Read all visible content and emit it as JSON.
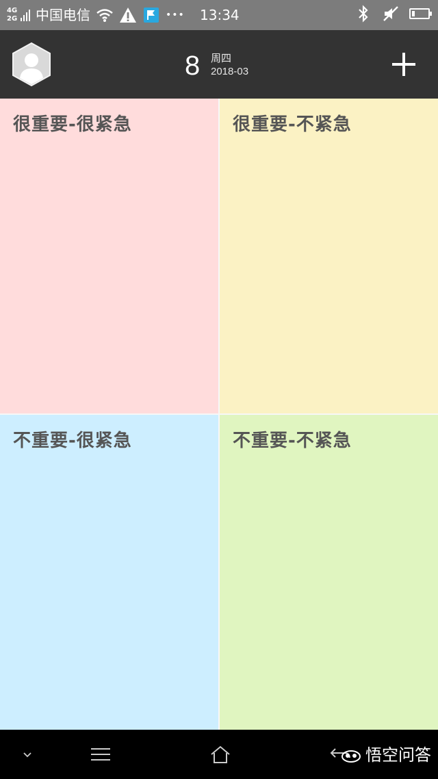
{
  "status_bar": {
    "network_top": "4G",
    "network_bottom": "2G",
    "carrier": "中国电信",
    "more_dots": "•••",
    "time": "13:34",
    "battery_level": 0.2
  },
  "header": {
    "day": "8",
    "weekday": "周四",
    "year_month": "2018-03"
  },
  "quadrants": [
    {
      "label": "很重要-很紧急",
      "color": "#ffdcdc"
    },
    {
      "label": "很重要-不紧急",
      "color": "#fbf2c4"
    },
    {
      "label": "不重要-很紧急",
      "color": "#cdeeff"
    },
    {
      "label": "不重要-不紧急",
      "color": "#e0f5c0"
    }
  ],
  "watermark": {
    "text": "悟空问答"
  },
  "icons": {
    "avatar": "hexagon-user-avatar",
    "add": "plus-icon",
    "nav_down": "chevron-down-icon",
    "nav_menu": "menu-icon",
    "nav_home": "home-icon",
    "nav_back": "back-icon"
  }
}
